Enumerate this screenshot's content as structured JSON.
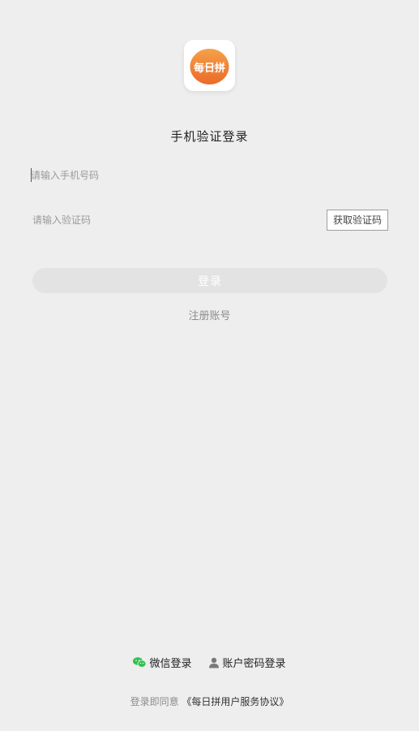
{
  "app": {
    "logo_text": "每日拼",
    "brand_color": "#f07a2f",
    "icon": "basket-logo-icon"
  },
  "header": {
    "title": "手机验证登录"
  },
  "form": {
    "phone_placeholder": "请输入手机号码",
    "phone_value": "",
    "code_placeholder": "请输入验证码",
    "code_value": "",
    "get_code_label": "获取验证码",
    "login_label": "登录",
    "register_label": "注册账号"
  },
  "alt_login": {
    "wechat_label": "微信登录",
    "wechat_icon": "wechat-icon",
    "wechat_color": "#2ec24d",
    "account_label": "账户密码登录",
    "account_icon": "user-icon"
  },
  "agreement": {
    "prefix": "登录即同意",
    "link_text": "《每日拼用户服务协议》"
  }
}
